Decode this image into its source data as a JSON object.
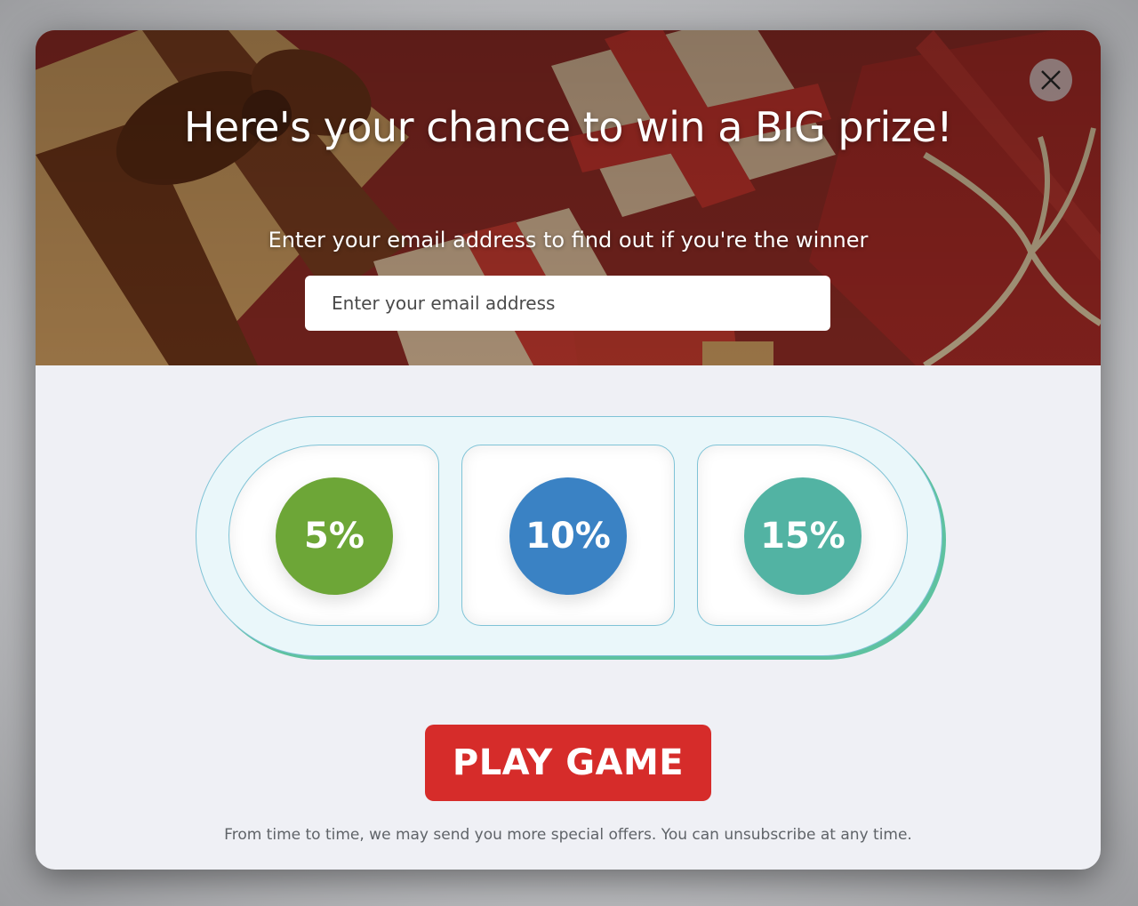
{
  "popup": {
    "headline": "Here's your chance to win a BIG prize!",
    "subheadline": "Enter your email address to find out if you're the winner",
    "email_placeholder": "Enter your email address",
    "close_icon": "close-icon"
  },
  "game": {
    "slots": [
      {
        "label": "5%",
        "color": "#6da637"
      },
      {
        "label": "10%",
        "color": "#3a82c4"
      },
      {
        "label": "15%",
        "color": "#52b3a3"
      }
    ],
    "play_label": "PLAY GAME",
    "play_color": "#d62c2a"
  },
  "footer": {
    "disclaimer": "From time to time, we may send you more special offers. You can unsubscribe at any time."
  }
}
